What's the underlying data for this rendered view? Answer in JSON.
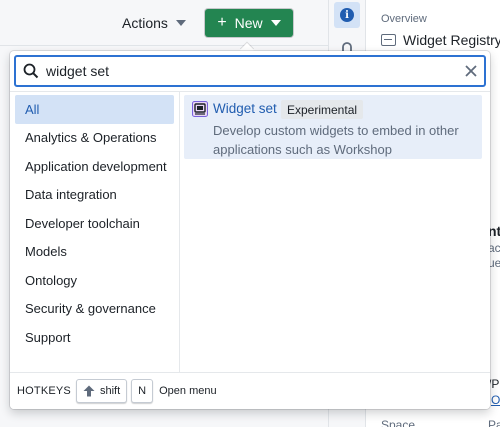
{
  "header": {
    "actions_label": "Actions",
    "new_label": "New",
    "new_color": "#238551"
  },
  "side_panel": {
    "overview_label": "Overview",
    "title": "Widget Registry",
    "space_label": "Space",
    "fragments": {
      "a": "nta",
      "b": "act",
      "c": "ues",
      "d": "/P",
      "e": "O",
      "f": "Pa"
    }
  },
  "search": {
    "value": "widget set",
    "placeholder": ""
  },
  "categories": [
    {
      "label": "All",
      "active": true
    },
    {
      "label": "Analytics & Operations"
    },
    {
      "label": "Application development"
    },
    {
      "label": "Data integration"
    },
    {
      "label": "Developer toolchain"
    },
    {
      "label": "Models"
    },
    {
      "label": "Ontology"
    },
    {
      "label": "Security & governance"
    },
    {
      "label": "Support"
    }
  ],
  "results": [
    {
      "title": "Widget set",
      "tag": "Experimental",
      "description": "Develop custom widgets to embed in other applications such as Workshop",
      "icon": "widget-set-icon"
    }
  ],
  "footer": {
    "hotkeys_label": "HOTKEYS",
    "key1": "shift",
    "key2": "N",
    "action": "Open menu"
  },
  "colors": {
    "accent": "#2d72d2",
    "active_bg": "#d3e2f6",
    "result_bg": "#e7eef9"
  }
}
